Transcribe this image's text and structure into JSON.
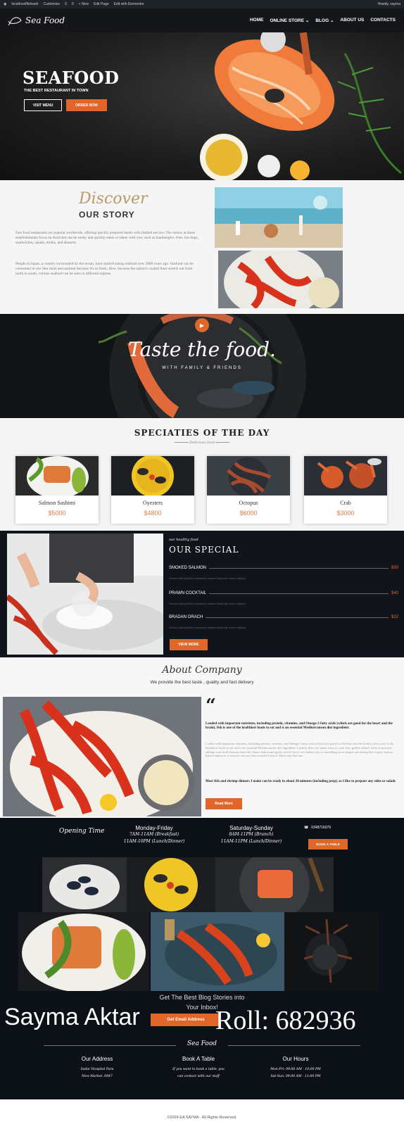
{
  "admin_bar": {
    "items": [
      "localhost/fishweb",
      "Customize",
      "0",
      "0",
      "+ New",
      "Edit Page",
      "Edit with Elementor"
    ],
    "greeting": "Howdy, sayma"
  },
  "nav": {
    "logo_text": "Sea Food",
    "items": [
      "HOME",
      "ONLINE STORE",
      "BLOG",
      "ABOUT US",
      "CONTACTS"
    ]
  },
  "hero": {
    "title": "SEAFOOD",
    "subtitle": "THE BEST RESTAURANT IN TOWN",
    "btn_menu": "VISIT MENU",
    "btn_order": "ORDER NOW"
  },
  "story": {
    "script_title": "Discover",
    "title": "OUR STORY",
    "para1": "Fast food restaurants are popular worldwide, offering quickly prepared meals with limited service. The menus at these establishments focus on food that can be easily and quickly eaten or taken with you, such as hamburgers, fries, hot dogs, sandwiches, salads, drinks, and desserts.",
    "para2": "People in Japan, a country surrounded by the ocean, have started eating seafood over 3000 years ago. Seafood can be consumed in raw like sushi and sashimi because it's so fresh. Also, because the nation's coastal lines stretch out from north to south, various seafood can be seen in different regions."
  },
  "taste": {
    "title": "Taste the food.",
    "subtitle": "WITH FAMILY & FRIENDS"
  },
  "specialties": {
    "title": "SPECIATIES OF THE DAY",
    "script": "Delicious food",
    "items": [
      {
        "name": "Salmon Sashimi",
        "price": "$5000"
      },
      {
        "name": "Oyesters",
        "price": "$4800"
      },
      {
        "name": "Octopus",
        "price": "$6000"
      },
      {
        "name": "Crab",
        "price": "$3000"
      }
    ]
  },
  "special": {
    "script": "our healthy food",
    "title": "OUR SPECIAL",
    "items": [
      {
        "name": "SMOKED SALMON",
        "price": "$50",
        "desc": "Served with pickled cucumber roasted beetroot creme fraiche"
      },
      {
        "name": "PRAWN COCKTAIL",
        "price": "$40",
        "desc": "Served with pickled cucumber roasted beetroot creme fraiche"
      },
      {
        "name": "BRADAN ORACH",
        "price": "$32",
        "desc": "Served with pickled cucumber roasted beetroot creme fraiche"
      }
    ],
    "btn": "VIEW MORE"
  },
  "about": {
    "script_title": "About Company",
    "tagline": "We provide the best taste , quality and fast delivery",
    "quote_mark": "“",
    "p1": "Loaded with important nutrients, including protein, vitamins, and Omega-3 fatty acids (which are good for the heart and the brain), fish is one of the healthiest foods to eat and is an essential Mediterranean diet ingredient.",
    "p2": "Loaded with important nutrients, including protein, vitamins, and Omega-3 fatty acids (which are good for the heart and the brain), fish is one of the healthiest foods to eat and is an essential Mediterranean diet ingredient. Luckily, there are many ways to cook fish: grilled, baked, fried or steamed - adding some bold flavours from the classic lemon and garlic which I love over baked cod, to something more unique and daring like a spicy harissa baked salmon or a savoury one-pot fish created in classic Moroccan flavours.",
    "p3": "Most fish and shrimp dinners I make can be ready in about 20 minutes (including prep), so I like to prepare any sides or salads",
    "btn": "Read More"
  },
  "opening": {
    "label": "Opening Time",
    "col1": {
      "title": "Monday-Friday",
      "l1": "7AM-11AM (Breakfast)",
      "l2": "11AM-10PM (Lunch/Dinner)"
    },
    "col2": {
      "title": "Saturday-Sunday",
      "l1": "8AM-11PM (Brunch)",
      "l2": "11AM-11PM (Lunch/Dinner)"
    },
    "phone": "0348716079",
    "btn": "BOOK A TABLE"
  },
  "newsletter": {
    "text_line1": "Get The Best Blog Stories into",
    "text_line2": "Your Inbox!",
    "btn": "Get Email Address"
  },
  "overlay": {
    "name": "Sayma Aktar",
    "roll": "Roll: 682936"
  },
  "footer": {
    "logo_text": "Sea Food",
    "cols": [
      {
        "title": "Our Address",
        "l1": "Sadar Hospital Para",
        "l2": "New Market, 6847"
      },
      {
        "title": "Book A Table",
        "l1": "If you want to book a table, you",
        "l2": "can contact with our staff"
      },
      {
        "title": "Our Hours",
        "l1": "Mon-Fri: 09:00 AM - 10:00 PM",
        "l2": "Sat-Sun: 09:00 AM - 11:00 PM"
      }
    ],
    "copyright": "©2024 EA SAYMA . All Rights Reserved."
  }
}
